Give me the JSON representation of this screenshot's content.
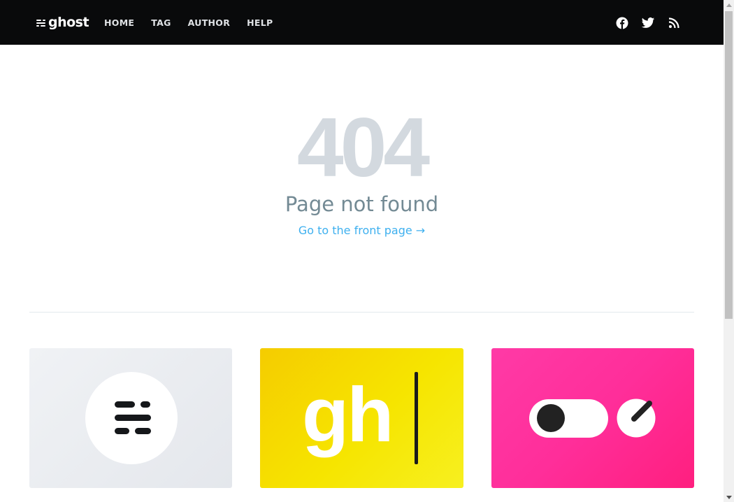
{
  "header": {
    "logo_text": "ghost",
    "nav": [
      {
        "label": "HOME"
      },
      {
        "label": "TAG"
      },
      {
        "label": "AUTHOR"
      },
      {
        "label": "HELP"
      }
    ],
    "social": [
      {
        "icon": "facebook-icon"
      },
      {
        "icon": "twitter-icon"
      },
      {
        "icon": "rss-icon"
      }
    ]
  },
  "error": {
    "code": "404",
    "description": "Page not found",
    "link_label": "Go to the front page →"
  },
  "cards": [
    {
      "image": "ghost-logo-circle-image"
    },
    {
      "image": "gh-typing-image"
    },
    {
      "image": "toggle-knob-image"
    }
  ],
  "colors": {
    "header_bg": "#090a0b",
    "error_code": "#d3d9df",
    "description": "#738a94",
    "link": "#3eb0ef",
    "card_yellow": "#f6e500",
    "card_pink": "#ff2e9a"
  }
}
